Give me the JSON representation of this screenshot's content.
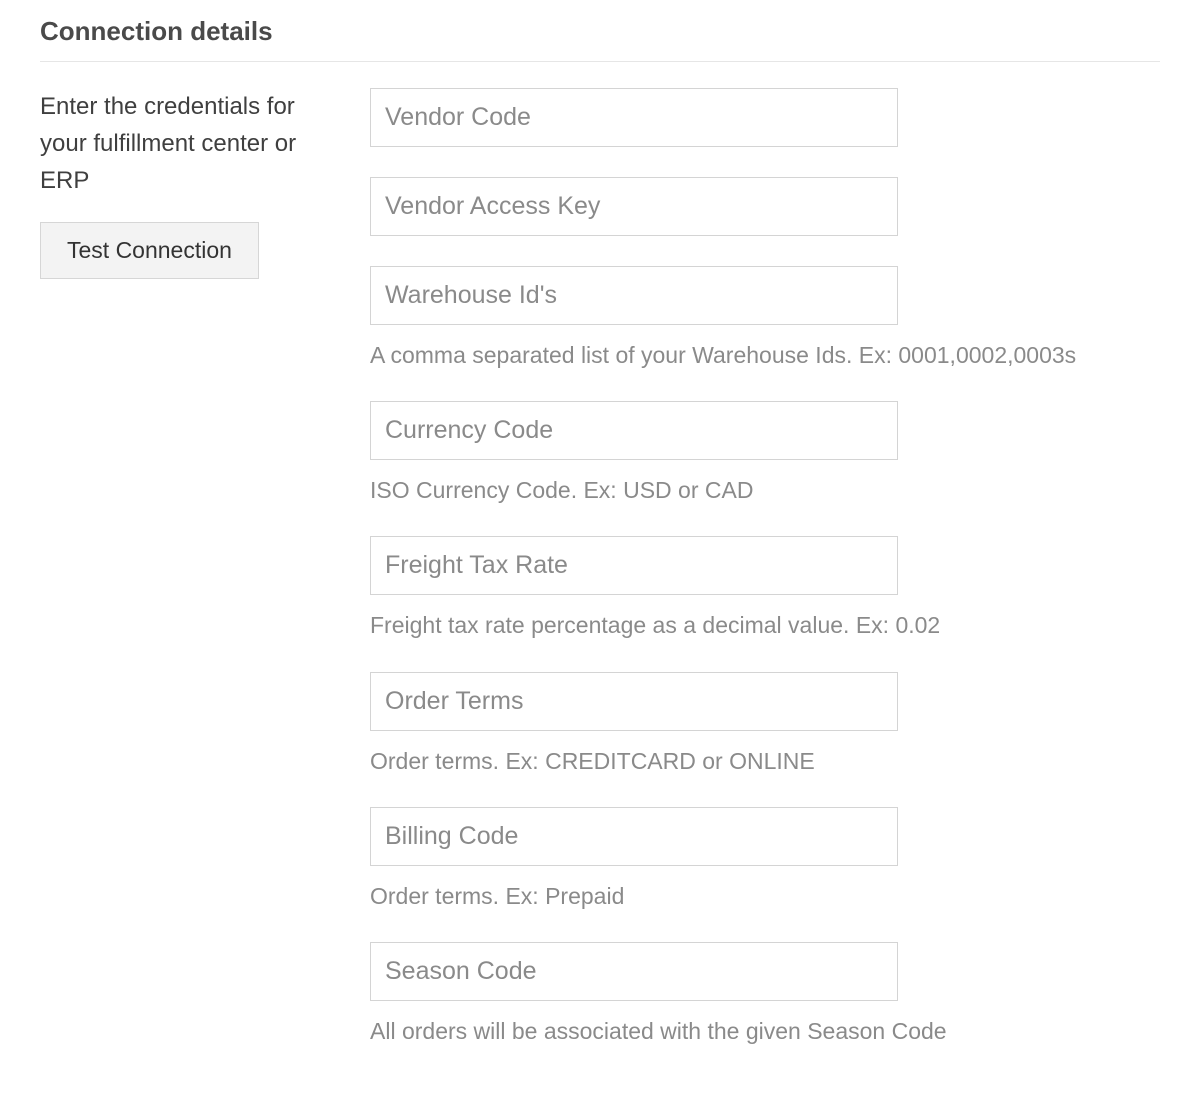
{
  "section": {
    "title": "Connection details",
    "intro": "Enter the credentials for your fulfillment center or ERP",
    "test_button_label": "Test Connection"
  },
  "fields": {
    "vendor_code": {
      "placeholder": "Vendor Code",
      "value": "",
      "help": ""
    },
    "vendor_access_key": {
      "placeholder": "Vendor Access Key",
      "value": "",
      "help": ""
    },
    "warehouse_ids": {
      "placeholder": "Warehouse Id's",
      "value": "",
      "help": "A comma separated list of your Warehouse Ids. Ex: 0001,0002,0003s"
    },
    "currency_code": {
      "placeholder": "Currency Code",
      "value": "",
      "help": "ISO Currency Code. Ex: USD or CAD"
    },
    "freight_tax_rate": {
      "placeholder": "Freight Tax Rate",
      "value": "",
      "help": "Freight tax rate percentage as a decimal value. Ex: 0.02"
    },
    "order_terms": {
      "placeholder": "Order Terms",
      "value": "",
      "help": "Order terms. Ex: CREDITCARD or ONLINE"
    },
    "billing_code": {
      "placeholder": "Billing Code",
      "value": "",
      "help": "Order terms. Ex: Prepaid"
    },
    "season_code": {
      "placeholder": "Season Code",
      "value": "",
      "help": "All orders will be associated with the given Season Code"
    }
  }
}
